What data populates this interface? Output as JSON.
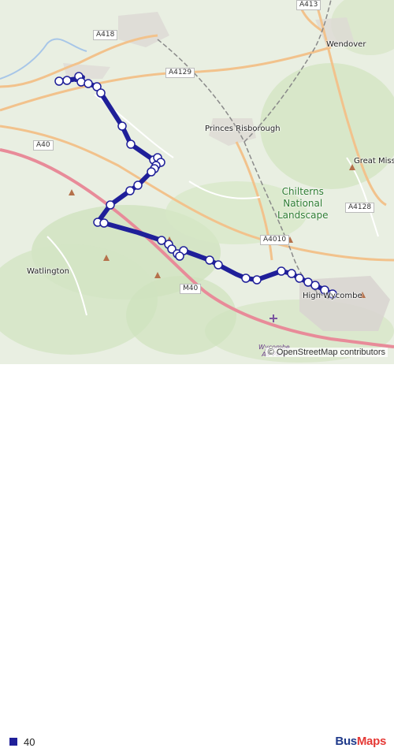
{
  "map": {
    "road_labels": [
      "A418",
      "A4129",
      "A40",
      "A4010",
      "A4128",
      "M40",
      "A413"
    ],
    "town_labels": [
      "Princes Risborough",
      "Watlington",
      "Wendover",
      "Great Missenden",
      "High Wycombe"
    ],
    "park_label": [
      "Chilterns",
      "National",
      "Landscape"
    ],
    "airport_label": [
      "Wycombe",
      "Air Park"
    ],
    "attribution": "© OpenStreetMap contributors",
    "colors": {
      "route": "#1f1f99",
      "stop_fill": "#ffffff",
      "background": "#e9efe2"
    }
  },
  "legend": {
    "route_label": "40",
    "route_color": "#1f1f99"
  },
  "brand": {
    "part1": "Bus",
    "part2": "Maps"
  }
}
